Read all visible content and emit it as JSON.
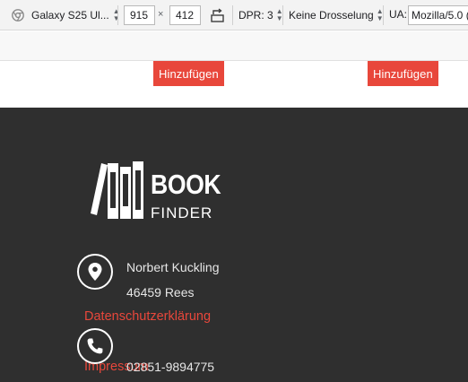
{
  "devtools": {
    "device": "Galaxy S25 Ul...",
    "width": "915",
    "times": "×",
    "height": "412",
    "dpr": "DPR: 3",
    "throttling": "Keine Drosselung",
    "ua_label": "UA:",
    "ua_value": "Mozilla/5.0 (",
    "icons": [
      "chrome-icon",
      "rotate-icon"
    ]
  },
  "page": {
    "buttons": [
      "Hinzufügen",
      "Hinzufügen"
    ],
    "logo": {
      "line1": "BOOK",
      "line2": "FINDER"
    },
    "contact": {
      "name": "Norbert Kuckling",
      "city": "46459 Rees",
      "phone": "02851-9894775"
    },
    "links": {
      "privacy": "Datenschutzerklärung",
      "imprint": "Impressum"
    },
    "colors": {
      "accent": "#e8473b",
      "footer_bg": "#2f2f2f"
    }
  }
}
